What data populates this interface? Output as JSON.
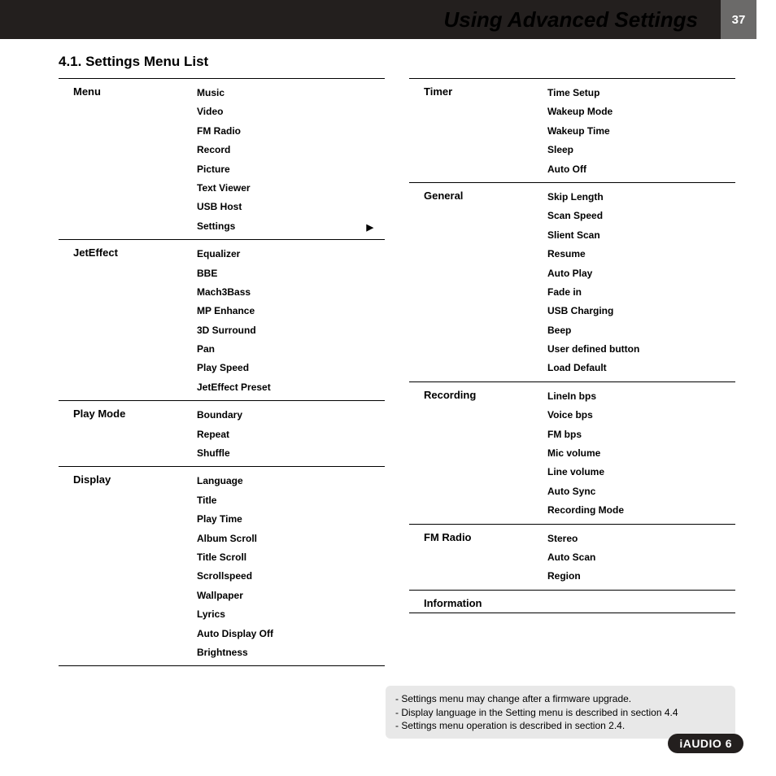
{
  "header": {
    "title": "Using Advanced Settings",
    "page_number": "37"
  },
  "section_title": "4.1. Settings Menu List",
  "columns": [
    [
      {
        "category": "Menu",
        "items": [
          "Music",
          "Video",
          "FM Radio",
          "Record",
          "Picture",
          "Text Viewer",
          "USB Host",
          "Settings"
        ],
        "arrow_on_last": true
      },
      {
        "category": "JetEffect",
        "items": [
          "Equalizer",
          "BBE",
          "Mach3Bass",
          "MP Enhance",
          "3D Surround",
          "Pan",
          "Play Speed",
          "JetEffect Preset"
        ]
      },
      {
        "category": "Play Mode",
        "items": [
          "Boundary",
          "Repeat",
          "Shuffle"
        ]
      },
      {
        "category": "Display",
        "items": [
          "Language",
          "Title",
          "Play Time",
          "Album Scroll",
          "Title Scroll",
          "Scrollspeed",
          "Wallpaper",
          "Lyrics",
          "Auto Display Off",
          "Brightness"
        ]
      }
    ],
    [
      {
        "category": "Timer",
        "items": [
          "Time Setup",
          "Wakeup Mode",
          "Wakeup Time",
          "Sleep",
          "Auto Off"
        ]
      },
      {
        "category": "General",
        "items": [
          "Skip Length",
          "Scan Speed",
          "Slient Scan",
          "Resume",
          "Auto Play",
          "Fade in",
          "USB Charging",
          "Beep",
          "User defined button",
          "Load Default"
        ]
      },
      {
        "category": "Recording",
        "items": [
          "LineIn bps",
          "Voice bps",
          "FM bps",
          "Mic volume",
          "Line volume",
          "Auto Sync",
          "Recording Mode"
        ]
      },
      {
        "category": "FM Radio",
        "items": [
          "Stereo",
          "Auto Scan",
          "Region"
        ]
      },
      {
        "category": "Information",
        "items": []
      }
    ]
  ],
  "notes": [
    "- Settings menu may change after a firmware upgrade.",
    "- Display language in the Setting menu is described in section 4.4",
    "- Settings menu operation is described in section 2.4."
  ],
  "footer_badge": "iAUDIO 6"
}
